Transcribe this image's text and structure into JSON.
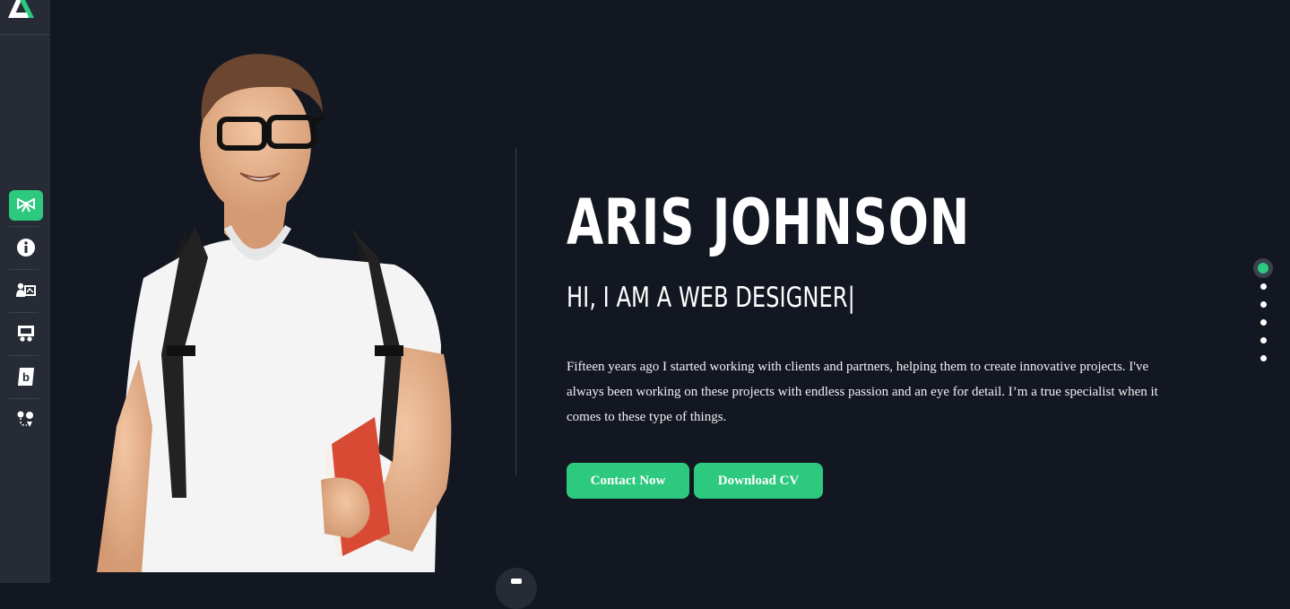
{
  "brand": {
    "accent": "#2cc97f",
    "background": "#131722",
    "sidebar": "#262b36"
  },
  "sidebar": {
    "items": [
      {
        "icon": "bow-icon",
        "active": true
      },
      {
        "icon": "info-icon",
        "active": false
      },
      {
        "icon": "user-card-icon",
        "active": false
      },
      {
        "icon": "portfolio-icon",
        "active": false
      },
      {
        "icon": "blog-icon",
        "active": false
      },
      {
        "icon": "map-route-icon",
        "active": false
      }
    ]
  },
  "hero": {
    "name": "ARIS JOHNSON",
    "role": "HI, I AM A WEB DESIGNER",
    "cursor": "|",
    "bio": "Fifteen years ago I started working with clients and partners, helping them to create innovative projects. I've always been working on these projects with endless passion and an eye for detail. I’m a true specialist when it comes to these type of things.",
    "contact_label": "Contact Now",
    "download_label": "Download CV"
  },
  "section_dots": {
    "count": 6,
    "active_index": 0
  }
}
